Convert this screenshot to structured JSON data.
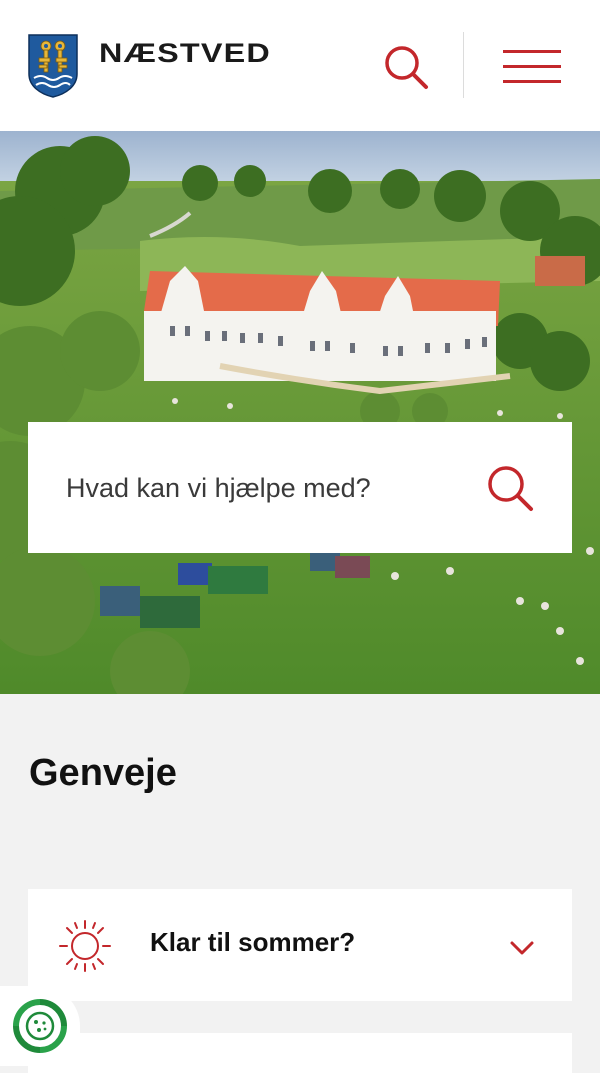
{
  "header": {
    "logo_text": "NÆSTVED",
    "icons": {
      "crest": "municipality-crest-icon",
      "search": "search-icon",
      "menu": "hamburger-menu-icon"
    }
  },
  "hero": {
    "image": "aerial photo of manor house with red roofs and green lawn with market tents",
    "search": {
      "placeholder": "Hvad kan vi hjælpe med?"
    }
  },
  "shortcuts": {
    "title": "Genveje",
    "items": [
      {
        "label": "Klar til sommer?",
        "icon": "sun-icon",
        "expand_icon": "chevron-down-icon"
      }
    ]
  },
  "cookie_badge": {
    "icon": "cookie-consent-icon"
  },
  "colors": {
    "brand_red": "#c3272b",
    "crest_blue": "#1f5a9e",
    "page_background": "#f2f2f2",
    "card_background": "#ffffff"
  }
}
